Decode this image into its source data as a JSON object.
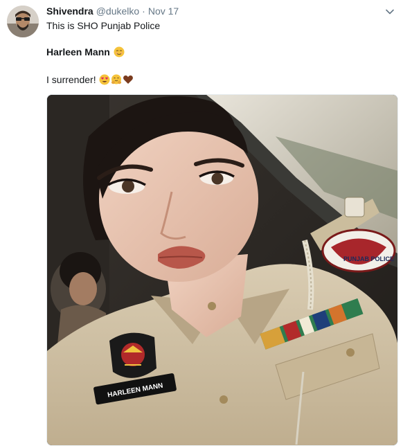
{
  "tweet": {
    "author": {
      "display_name": "Shivendra",
      "handle": "@dukelko",
      "avatar_icon": "user-avatar"
    },
    "separator": "·",
    "timestamp": "Nov 17",
    "menu_icon": "chevron-down-icon",
    "lines": [
      "This is SHO Punjab Police",
      "Harleen Mann",
      "I surrender!"
    ],
    "emojis": {
      "after_name": [
        "relieved-face-emoji"
      ],
      "after_surrender": [
        "heart-eyes-emoji",
        "hugging-face-emoji",
        "brown-heart-emoji"
      ]
    },
    "media": {
      "name_tag": "HARLEEN MANN",
      "shoulder_badge": "PUNJAB POLICE"
    }
  },
  "colors": {
    "text": "#14171a",
    "muted": "#657786",
    "uniform": "#cfc1a6"
  }
}
